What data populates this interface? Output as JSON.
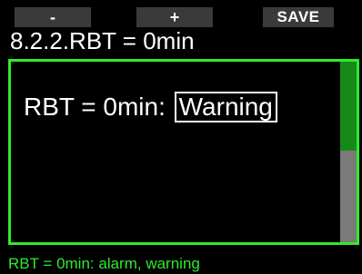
{
  "softkeys": {
    "minus_label": "-",
    "plus_label": "+",
    "save_label": "SAVE"
  },
  "header": {
    "title": "8.2.2.RBT = 0min"
  },
  "setting": {
    "label": "RBT = 0min:",
    "value": "Warning"
  },
  "scrollbar": {
    "position_fraction": 0.0,
    "visible_fraction": 0.49
  },
  "status": {
    "text": "RBT = 0min: alarm, warning"
  },
  "colors": {
    "accent_green": "#2eea2e",
    "scroll_thumb": "#168a16",
    "scroll_track": "#7a7a7a",
    "softkey_bg": "#3a3a3a",
    "background": "#000000"
  }
}
